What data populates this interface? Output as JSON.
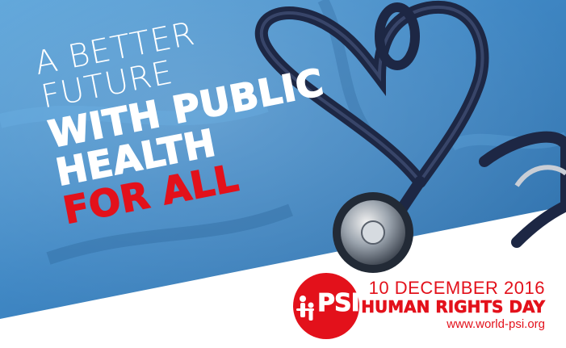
{
  "headline": {
    "line1": "A BETTER",
    "line2": "FUTURE",
    "line3": "WITH PUBLIC",
    "line4": "HEALTH",
    "line5": "FOR ALL"
  },
  "logo": {
    "text": "PSI"
  },
  "footer": {
    "date": "10 DECEMBER 2016",
    "event": "HUMAN RIGHTS DAY",
    "url": "www.world-psi.org"
  },
  "colors": {
    "accent_red": "#e3111b",
    "photo_blue": "#4a90c9",
    "stethoscope": "#1f2a48"
  },
  "icons": [
    "heart-stethoscope-photo",
    "psi-logo"
  ]
}
